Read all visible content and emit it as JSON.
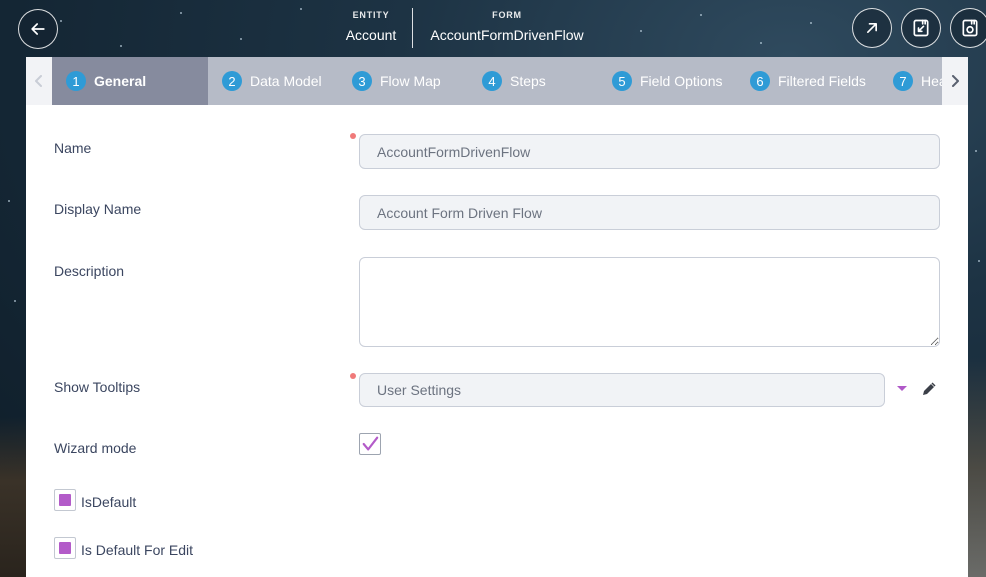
{
  "header": {
    "entity_label": "ENTITY",
    "entity_value": "Account",
    "form_label": "FORM",
    "form_value": "AccountFormDrivenFlow"
  },
  "tabs": [
    {
      "num": "1",
      "label": "General",
      "active": true
    },
    {
      "num": "2",
      "label": "Data Model"
    },
    {
      "num": "3",
      "label": "Flow Map"
    },
    {
      "num": "4",
      "label": "Steps"
    },
    {
      "num": "5",
      "label": "Field Options"
    },
    {
      "num": "6",
      "label": "Filtered Fields"
    },
    {
      "num": "7",
      "label": "Header"
    }
  ],
  "form": {
    "name_label": "Name",
    "name_value": "AccountFormDrivenFlow",
    "display_name_label": "Display Name",
    "display_name_value": "Account Form Driven Flow",
    "description_label": "Description",
    "description_value": "",
    "show_tooltips_label": "Show Tooltips",
    "show_tooltips_value": "User Settings",
    "wizard_mode_label": "Wizard mode",
    "wizard_mode_checked": true,
    "is_default_label": "IsDefault",
    "is_default_for_edit_label": "Is Default For Edit"
  },
  "colors": {
    "accent": "#b35bc9",
    "tab_number": "#2f9bd6",
    "required": "#f07a7a"
  }
}
